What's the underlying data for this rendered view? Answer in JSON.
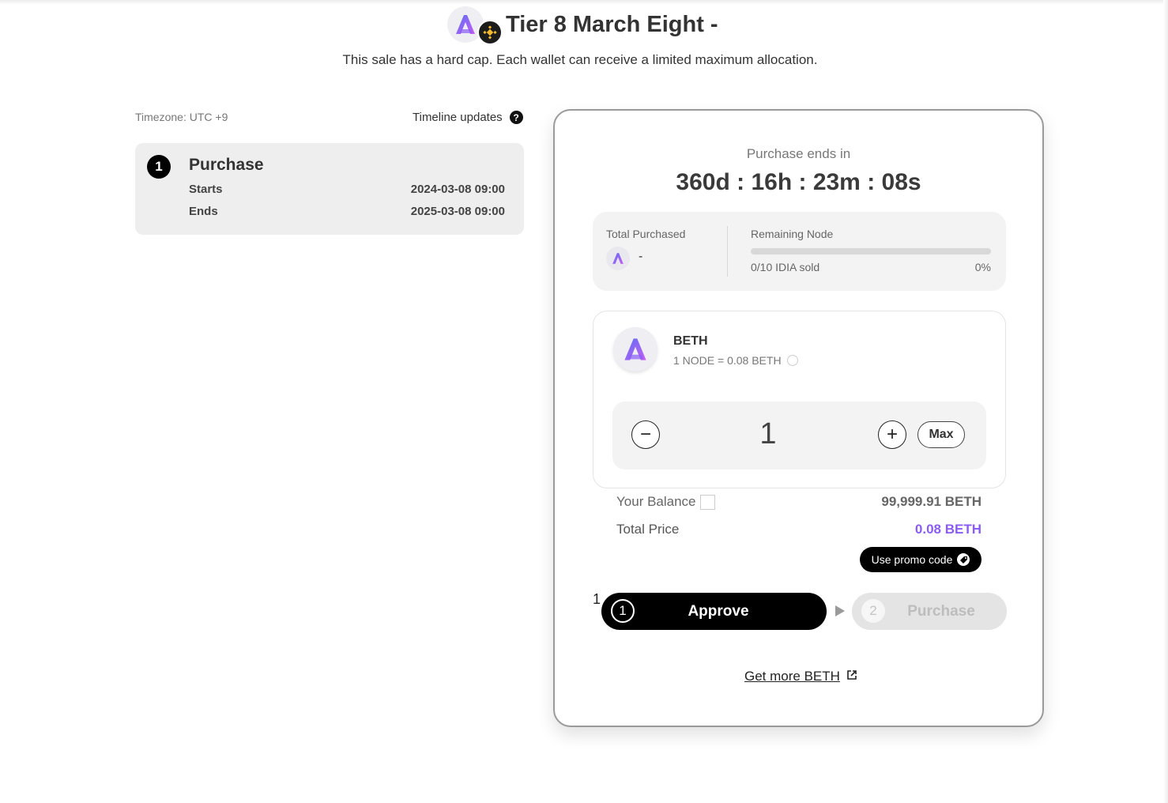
{
  "header": {
    "title": "Tier 8 March Eight -",
    "subtitle": "This sale has a hard cap. Each wallet can receive a limited maximum allocation.",
    "logo_icon": "project-logo-icon",
    "chain_icon": "bnb-chain-icon"
  },
  "timeline": {
    "timezone": "Timezone: UTC +9",
    "updates_label": "Timeline updates",
    "help_icon": "?",
    "phase": {
      "number": "1",
      "name": "Purchase",
      "starts_label": "Starts",
      "starts_value": "2024-03-08 09:00",
      "ends_label": "Ends",
      "ends_value": "2025-03-08 09:00"
    }
  },
  "panel": {
    "ends_label": "Purchase ends in",
    "countdown": "360d : 16h : 23m : 08s",
    "stats": {
      "purchased_label": "Total Purchased",
      "purchased_value": "-",
      "remaining_label": "Remaining Node",
      "sold_text": "0/10 IDIA sold",
      "percent_text": "0%",
      "progress_fraction": 0
    },
    "token": {
      "name": "BETH",
      "rate": "1 NODE = 0.08 BETH",
      "quantity": "1",
      "minus": "−",
      "plus": "+",
      "max_label": "Max"
    },
    "balance_label": "Your Balance",
    "balance_value": "99,999.91 BETH",
    "total_label": "Total Price",
    "total_value": "0.08 BETH",
    "promo_label": "Use promo code",
    "step_marker": "1",
    "approve": {
      "num": "1",
      "label": "Approve"
    },
    "purchase": {
      "num": "2",
      "label": "Purchase"
    },
    "get_more": "Get more BETH"
  },
  "colors": {
    "accent": "#8a5cf5",
    "primary_button": "#000000",
    "disabled_button": "#e4e4e4"
  }
}
